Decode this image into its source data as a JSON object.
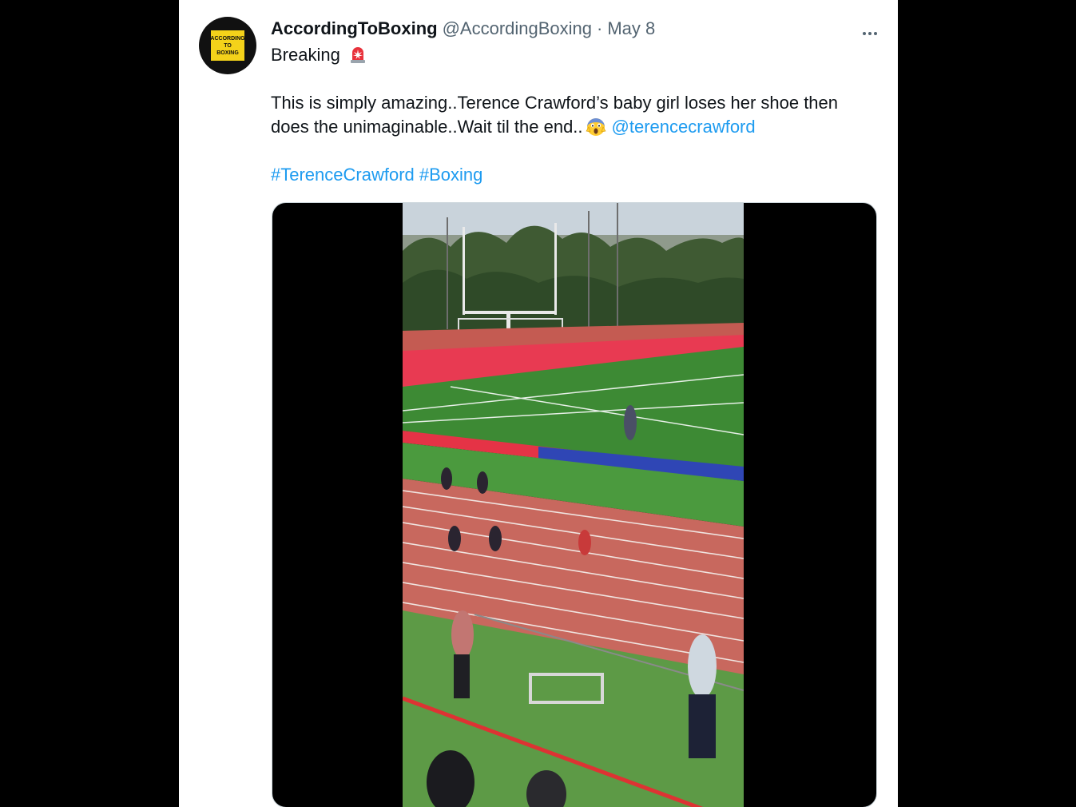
{
  "tweet": {
    "author": {
      "display_name": "AccordingToBoxing",
      "handle": "@AccordingBoxing",
      "avatar_text": [
        "ACCORDING",
        "TO",
        "BOXING"
      ]
    },
    "separator": "·",
    "date": "May 8",
    "text": {
      "line1": "Breaking",
      "line2": "This is simply amazing..Terence Crawford’s baby girl loses her shoe then",
      "line3": "does the unimaginable..Wait til the end..",
      "mention": "@terencecrawford",
      "hashtags": [
        "#TerenceCrawford",
        "#Boxing"
      ]
    },
    "icons": {
      "siren": "police-light-emoji-icon",
      "scream": "face-screaming-emoji-icon",
      "more": "more-options-icon"
    },
    "media": {
      "type": "video",
      "scene": "children running on a track at a stadium"
    }
  },
  "colors": {
    "link": "#1d9bf0",
    "text": "#0f1419",
    "secondary": "#536471",
    "background": "#ffffff",
    "page_background": "#000000"
  }
}
